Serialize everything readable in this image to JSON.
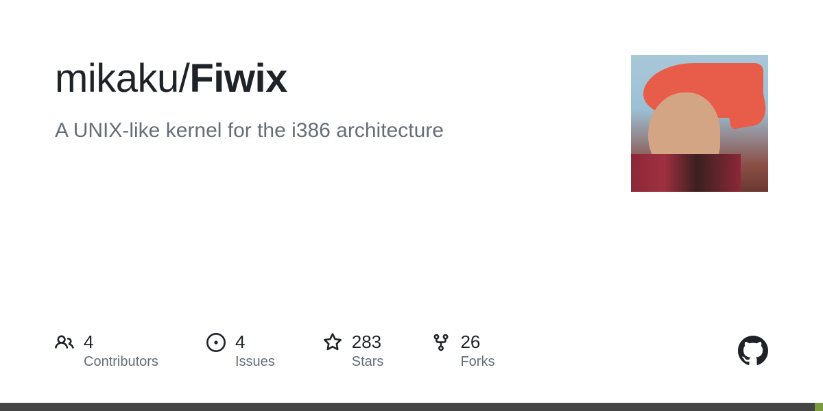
{
  "repo": {
    "owner": "mikaku",
    "separator": "/",
    "name": "Fiwix",
    "description": "A UNIX-like kernel for the i386 architecture"
  },
  "stats": {
    "contributors": {
      "count": "4",
      "label": "Contributors"
    },
    "issues": {
      "count": "4",
      "label": "Issues"
    },
    "stars": {
      "count": "283",
      "label": "Stars"
    },
    "forks": {
      "count": "26",
      "label": "Forks"
    }
  }
}
